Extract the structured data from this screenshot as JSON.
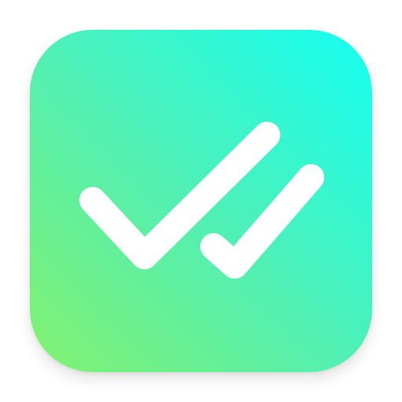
{
  "icon": {
    "name": "double-checkmark-app-icon",
    "glyph": "double-checkmark",
    "colors": {
      "gradient_start": "#84F16F",
      "gradient_mid": "#4FF0B6",
      "gradient_end": "#15FFF3",
      "glyph": "#FFFFFF",
      "page_background": "#FFFFFF"
    }
  }
}
